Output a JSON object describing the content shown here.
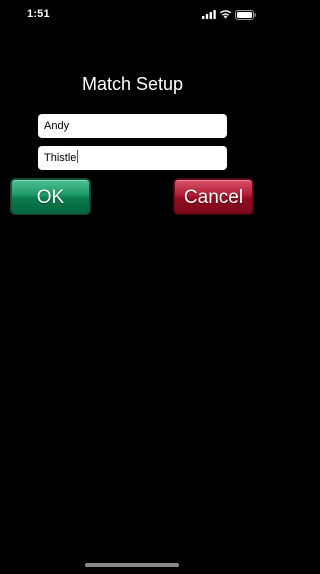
{
  "status_bar": {
    "time": "1:51",
    "icons": [
      "signal-icon",
      "wifi-icon",
      "battery-icon"
    ]
  },
  "screen": {
    "title": "Match Setup"
  },
  "form": {
    "player1_value": "Andy",
    "player2_value": "Thistle"
  },
  "buttons": {
    "ok_label": "OK",
    "cancel_label": "Cancel"
  },
  "colors": {
    "background": "#000000",
    "ok_button": "#0a7a4c",
    "cancel_button": "#930d22",
    "caret": "#1a4dff"
  }
}
